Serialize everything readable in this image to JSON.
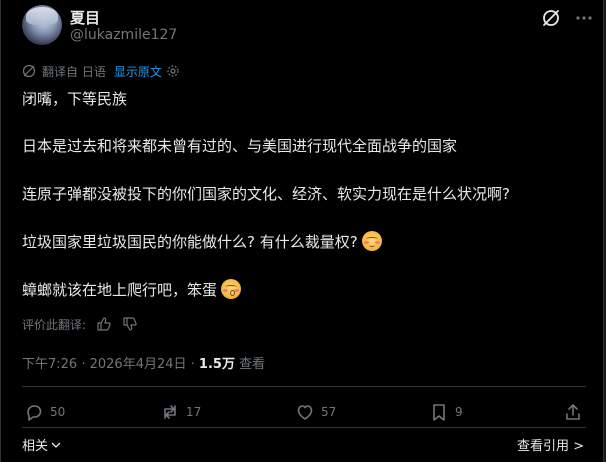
{
  "author": {
    "display_name": "夏目",
    "handle": "@lukazmile127"
  },
  "translation": {
    "label": "翻译自 日语",
    "show_original": "显示原文"
  },
  "post": {
    "lines": [
      "闭嘴，下等民族",
      "日本是过去和将来都未曾有过的、与美国进行现代全面战争的国家",
      "连原子弹都没被投下的你们国家的文化、经济、软实力现在是什么状况啊?",
      "垃圾国家里垃圾国民的你能做什么? 有什么裁量权?",
      "蟑螂就该在地上爬行吧，笨蛋"
    ]
  },
  "rate_translation": "评价此翻译:",
  "meta": {
    "time": "下午7:26",
    "sep": " · ",
    "date": "2026年4月24日",
    "sep2": " · ",
    "views_count": "1.5万",
    "views_label": " 查看"
  },
  "actions": {
    "replies": "50",
    "reposts": "17",
    "likes": "57",
    "bookmarks": "9"
  },
  "footer": {
    "related": "相关",
    "view_quotes": "查看引用 >"
  },
  "icons": {
    "grok": "grok-slash-icon",
    "more": "more-horizontal-icon",
    "translate": "translate-icon",
    "settings": "gear-icon",
    "thumbs_up": "thumbs-up-icon",
    "thumbs_down": "thumbs-down-icon",
    "reply": "reply-icon",
    "repost": "repost-icon",
    "like": "heart-icon",
    "bookmark": "bookmark-icon",
    "share": "share-icon"
  },
  "colors": {
    "background": "#000000",
    "text": "#e7e9ea",
    "muted": "#71767b",
    "link": "#1d9bf0",
    "divider": "#2f3336"
  }
}
